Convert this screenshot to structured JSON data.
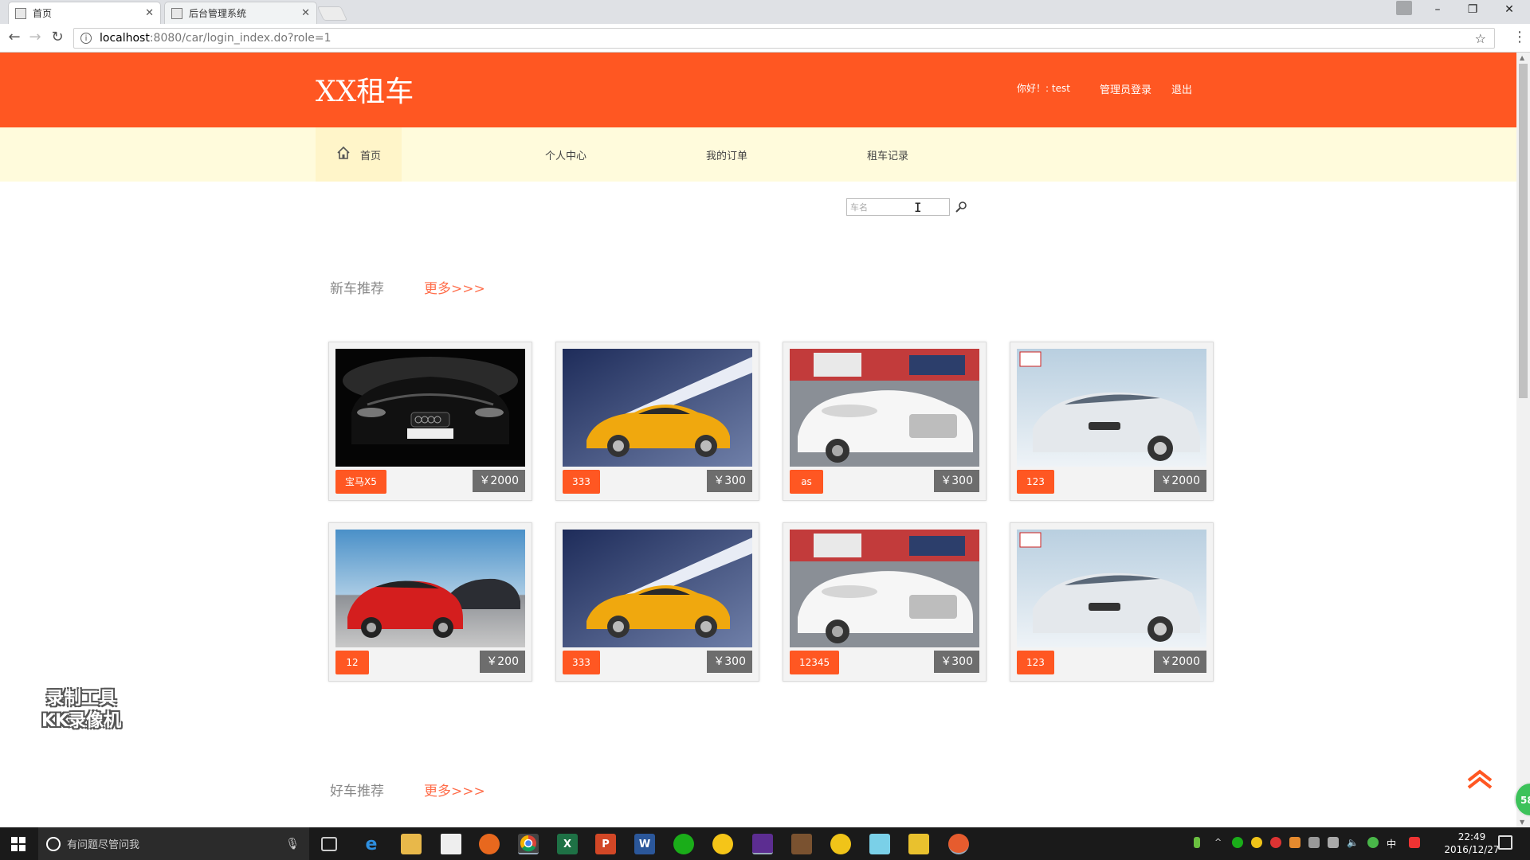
{
  "browser": {
    "tabs": [
      {
        "label": "首页",
        "active": true
      },
      {
        "label": "后台管理系统",
        "active": false
      }
    ],
    "address": {
      "host": "localhost",
      "path": ":8080/car/login_index.do?role=1"
    }
  },
  "header": {
    "logo": "XX租车",
    "greeting": "你好！: test",
    "admin_login": "管理员登录",
    "logout": "退出"
  },
  "nav": {
    "items": [
      "首页",
      "个人中心",
      "我的订单",
      "租车记录"
    ]
  },
  "search": {
    "placeholder": "车名"
  },
  "sections": [
    {
      "title": "新车推荐",
      "more": "更多>>>",
      "cars": [
        {
          "name": "宝马X5",
          "price": "￥2000",
          "image": "audi-tt-black"
        },
        {
          "name": "333",
          "price": "￥300",
          "image": "audi-tt-yellow"
        },
        {
          "name": "as",
          "price": "￥300",
          "image": "audi-a8-white"
        },
        {
          "name": "123",
          "price": "￥2000",
          "image": "kia-k5-silver"
        },
        {
          "name": "12",
          "price": "￥200",
          "image": "bmw-3-red"
        },
        {
          "name": "333",
          "price": "￥300",
          "image": "audi-tt-yellow"
        },
        {
          "name": "12345",
          "price": "￥300",
          "image": "audi-a8-white"
        },
        {
          "name": "123",
          "price": "￥2000",
          "image": "kia-k5-silver"
        }
      ]
    },
    {
      "title": "好车推荐",
      "more": "更多>>>"
    }
  ],
  "watermark": {
    "line1": "录制工具",
    "line2": "KK录像机"
  },
  "badge": "58",
  "taskbar": {
    "search_placeholder": "有问题尽管问我",
    "time": "22:49",
    "date": "2016/12/27",
    "ime": "中"
  },
  "colors": {
    "brand": "#ff5722",
    "nav_bg": "#fffbdc",
    "price_bg": "#6d6d6d"
  }
}
